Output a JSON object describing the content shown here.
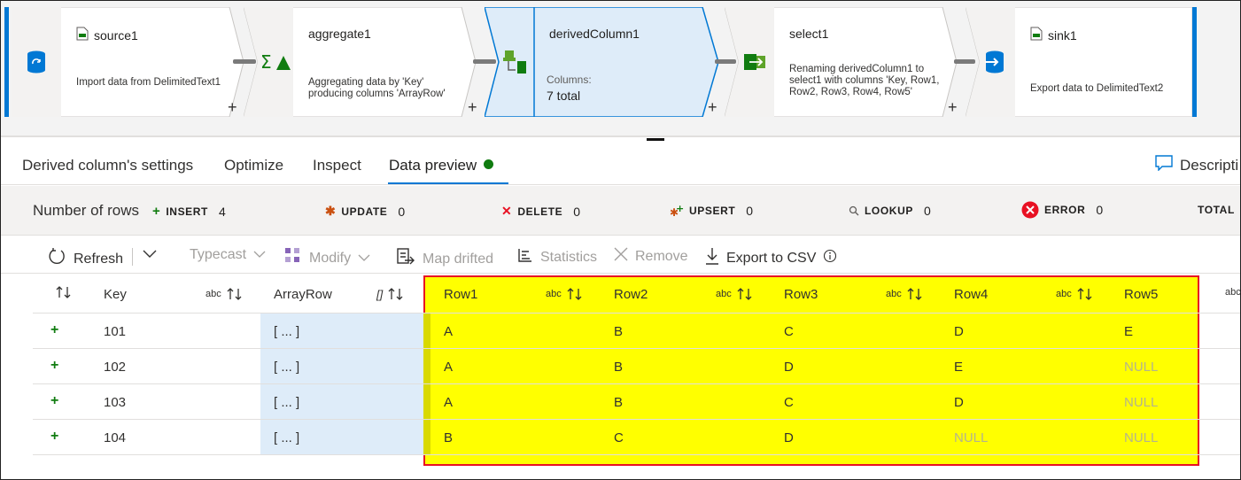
{
  "flow": {
    "nodes": [
      {
        "name": "source1",
        "description": "Import data from DelimitedText1"
      },
      {
        "name": "aggregate1",
        "description": "Aggregating data by 'Key' producing columns 'ArrayRow'"
      },
      {
        "name": "derivedColumn1",
        "columns_label": "Columns:",
        "columns_total": "7 total"
      },
      {
        "name": "select1",
        "description": "Renaming derivedColumn1 to select1 with columns 'Key, Row1, Row2, Row3, Row4, Row5'"
      },
      {
        "name": "sink1",
        "description": "Export data to DelimitedText2"
      }
    ],
    "plus_symbol": "+"
  },
  "tabs": {
    "items": [
      "Derived column's settings",
      "Optimize",
      "Inspect",
      "Data preview"
    ],
    "active": "Data preview",
    "description_tab": "Descripti"
  },
  "stats": {
    "label": "Number of rows",
    "insert": {
      "label": "INSERT",
      "value": "4"
    },
    "update": {
      "label": "UPDATE",
      "value": "0"
    },
    "delete": {
      "label": "DELETE",
      "value": "0"
    },
    "upsert": {
      "label": "UPSERT",
      "value": "0"
    },
    "lookup": {
      "label": "LOOKUP",
      "value": "0"
    },
    "error": {
      "label": "ERROR",
      "value": "0"
    },
    "total": {
      "label": "TOTAL"
    }
  },
  "toolbar": {
    "refresh": "Refresh",
    "typecast": "Typecast",
    "modify": "Modify",
    "map_drifted": "Map drifted",
    "statistics": "Statistics",
    "remove": "Remove",
    "export": "Export to CSV"
  },
  "grid": {
    "columns": [
      {
        "name": "Key",
        "type": "abc"
      },
      {
        "name": "ArrayRow",
        "type": "[]"
      },
      {
        "name": "Row1",
        "type": "abc"
      },
      {
        "name": "Row2",
        "type": "abc"
      },
      {
        "name": "Row3",
        "type": "abc"
      },
      {
        "name": "Row4",
        "type": "abc"
      },
      {
        "name": "Row5",
        "type": "abc"
      }
    ],
    "extra_type": "abc",
    "rows": [
      [
        "101",
        "[ ... ]",
        "A",
        "B",
        "C",
        "D",
        "E"
      ],
      [
        "102",
        "[ ... ]",
        "A",
        "B",
        "D",
        "E",
        "NULL"
      ],
      [
        "103",
        "[ ... ]",
        "A",
        "B",
        "C",
        "D",
        "NULL"
      ],
      [
        "104",
        "[ ... ]",
        "B",
        "C",
        "D",
        "NULL",
        "NULL"
      ]
    ],
    "row_marker": "+"
  },
  "colors": {
    "accent": "#0078d4",
    "insert": "#107c10",
    "error": "#e81123",
    "highlight": "#ffff00",
    "selected_node": "#deecf9"
  }
}
